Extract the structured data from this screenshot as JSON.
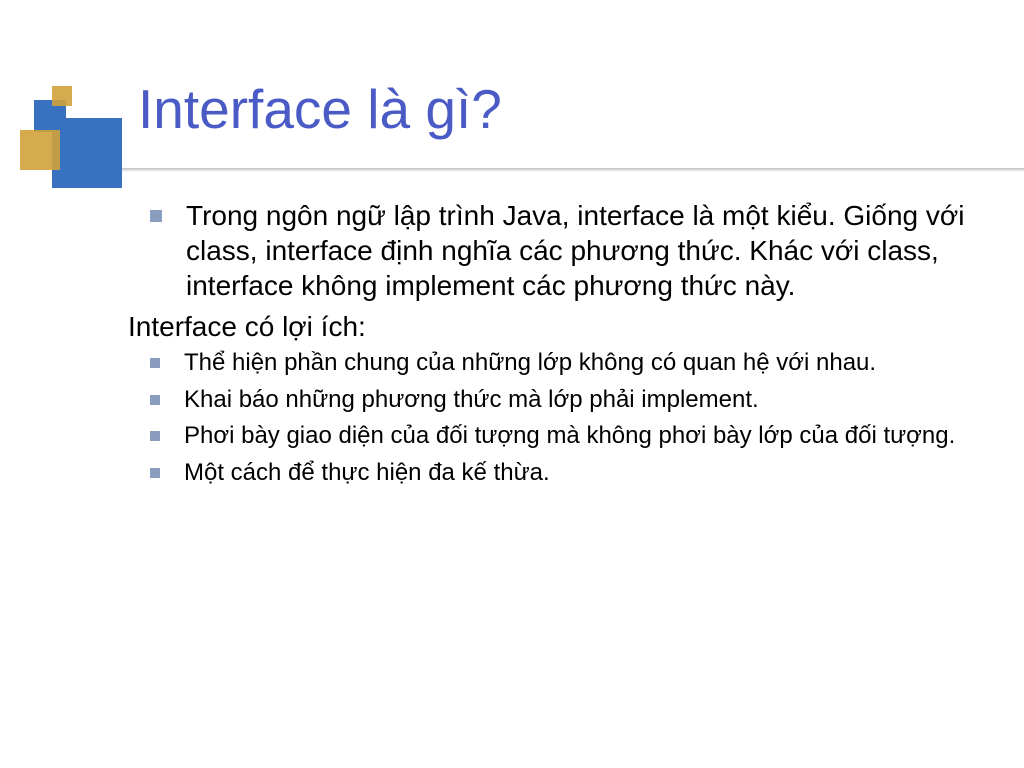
{
  "title": "Interface là gì?",
  "bullets_main": [
    "Trong ngôn ngữ lập trình Java, interface là một kiểu. Giống với class, interface định nghĩa các phương thức. Khác với class, interface không implement các phương thức này."
  ],
  "sub_heading": "Interface có lợi ích:",
  "bullets_sub": [
    "Thể hiện phần chung của những lớp không có quan hệ với nhau.",
    "Khai báo những phương thức mà lớp phải implement.",
    "Phơi bày giao diện của đối tượng mà không phơi bày lớp của đối tượng.",
    "Một cách để thực hiện đa kế thừa."
  ]
}
